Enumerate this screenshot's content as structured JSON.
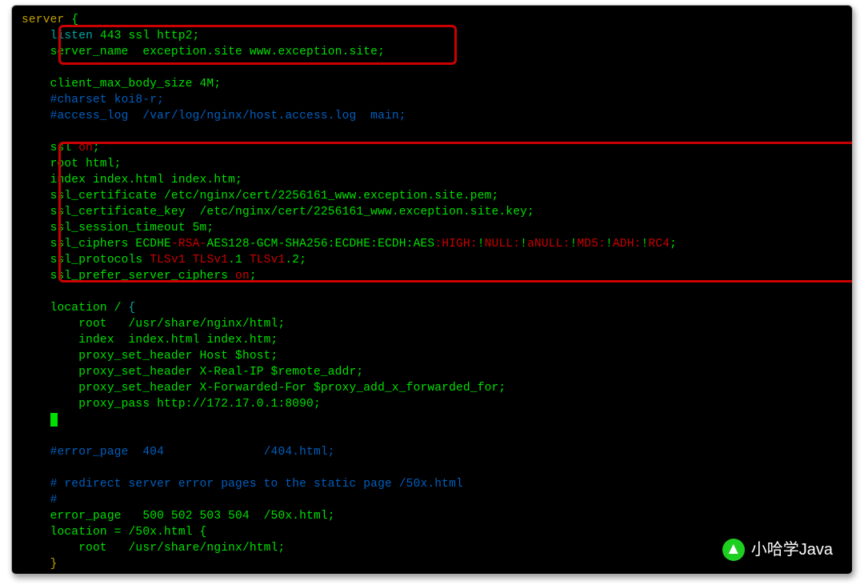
{
  "watermark": {
    "text": "小哈学Java"
  },
  "code": {
    "line01": {
      "a": "server",
      "b": " {"
    },
    "line02": {
      "a": "    listen",
      "b": " 443 ssl http2;"
    },
    "line03": {
      "a": "    server_name  exception.site www.exception.site;"
    },
    "line04": "",
    "line05": {
      "a": "    client_max_body_size 4M;"
    },
    "line06": {
      "a": "    #charset koi8-r;"
    },
    "line07": {
      "a": "    #access_log  /var/log/nginx/host.access.log  main;"
    },
    "line08": "",
    "line09": {
      "a": "    ssl ",
      "b": "on",
      "c": ";"
    },
    "line10": {
      "a": "    root html;"
    },
    "line11": {
      "a": "    index index.html index.htm;"
    },
    "line12": {
      "a": "    ssl_certificate /etc/nginx/cert/2256161_www.exception.site.pem;"
    },
    "line13": {
      "a": "    ssl_certificate_key  /etc/nginx/cert/2256161_www.exception.site.key;"
    },
    "line14": {
      "a": "    ssl_session_timeout 5m;"
    },
    "line15": {
      "a": "    ssl_ciphers ECDHE",
      "b": "-RSA-",
      "c": "AES128-GCM-SHA256:ECDHE:ECDH:AES",
      "d": ":HIGH:",
      "e": "!",
      "f": "NULL:",
      "g": "!",
      "h": "aNULL:",
      "i": "!",
      "j": "MD5:",
      "k": "!",
      "l": "ADH:",
      "m": "!",
      "n": "RC4",
      "o": ";"
    },
    "line16": {
      "a": "    ssl_protocols ",
      "b": "TLSv1 TLSv1",
      "c": ".1 ",
      "d": "TLSv1",
      "e": ".2;"
    },
    "line17": {
      "a": "    ssl_prefer_server_ciphers ",
      "b": "on",
      "c": ";"
    },
    "line18": "",
    "line19": {
      "a": "    location / ",
      "b": "{"
    },
    "line20": {
      "a": "        root   /usr/share/nginx/html;"
    },
    "line21": {
      "a": "        index  index.html index.htm;"
    },
    "line22": {
      "a": "        proxy_set_header Host $host;"
    },
    "line23": {
      "a": "        proxy_set_header X-Real-IP $remote_addr;"
    },
    "line24": {
      "a": "        proxy_set_header X-Forwarded-For $proxy_add_x_forwarded_for;"
    },
    "line25": {
      "a": "        proxy_pass http://172.17.0.1:8090;"
    },
    "line27": "",
    "line28": {
      "a": "    #error_page  404              /404.html;"
    },
    "line29": "",
    "line30": {
      "a": "    # redirect server error pages to the static page /50x.html"
    },
    "line31": {
      "a": "    #"
    },
    "line32": {
      "a": "    error_page   500 502 503 504  /50x.html;"
    },
    "line33": {
      "a": "    location = /50x.html {"
    },
    "line34": {
      "a": "        root   /usr/share/nginx/html;"
    },
    "line35": {
      "a": "    ",
      "b": "}"
    }
  }
}
